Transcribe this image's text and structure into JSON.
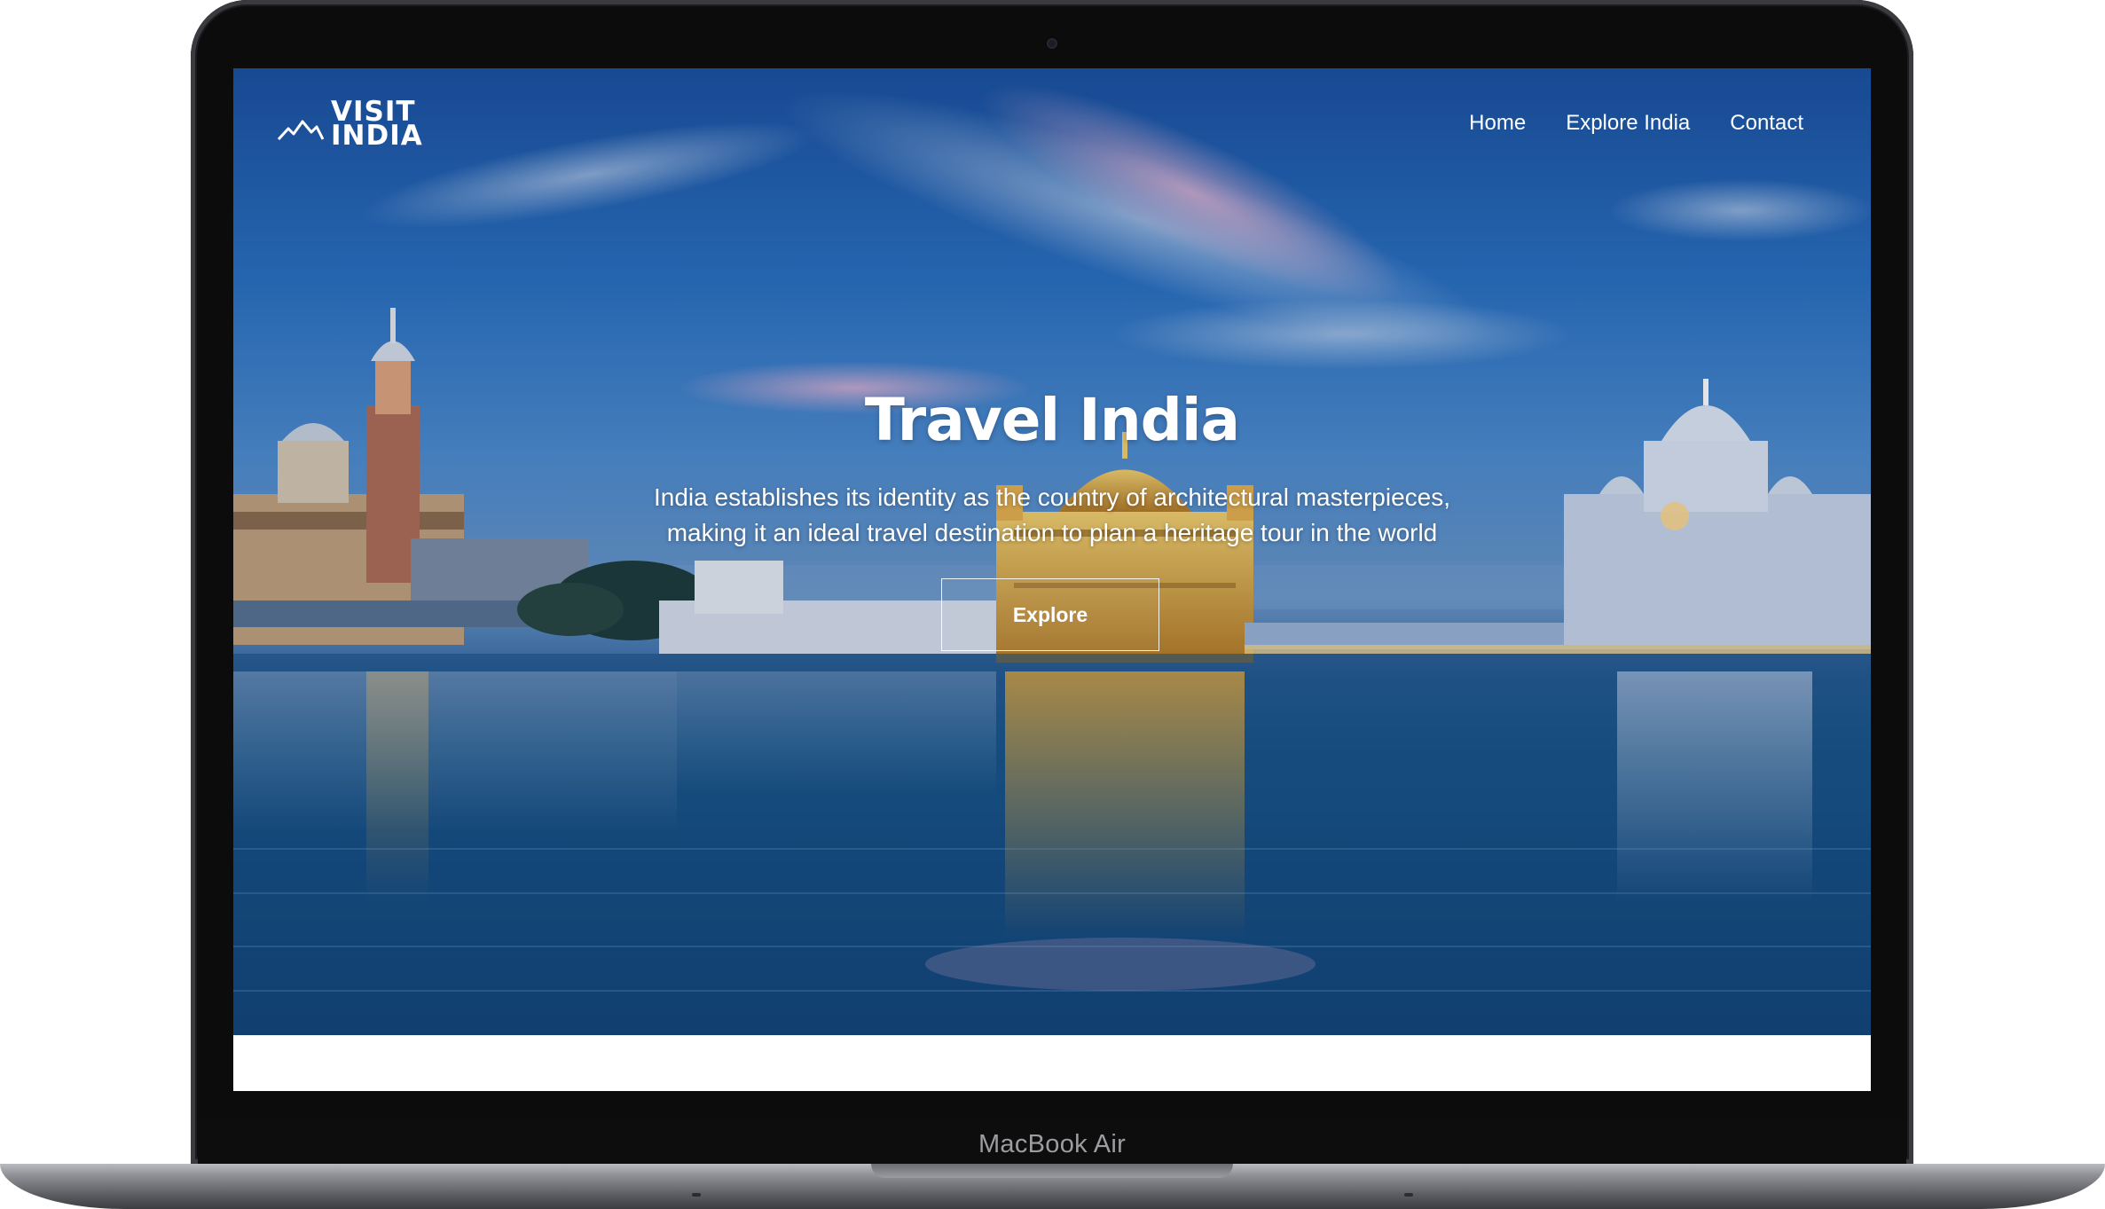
{
  "brand": {
    "line1": "VISIT",
    "line2": "INDIA",
    "icon": "mountain-logo-icon"
  },
  "nav": {
    "items": [
      {
        "label": "Home"
      },
      {
        "label": "Explore India"
      },
      {
        "label": "Contact"
      }
    ]
  },
  "hero": {
    "title": "Travel India",
    "subtitle_line1": "India establishes its identity as the country of architectural masterpieces,",
    "subtitle_line2": "making it an ideal travel destination to plan a heritage tour in the world",
    "cta_label": "Explore"
  },
  "device": {
    "label": "MacBook Air"
  },
  "colors": {
    "text": "#ffffff",
    "sky_top": "#1a4f9c",
    "water": "#164d80",
    "temple_gold": "#d9a23a"
  }
}
